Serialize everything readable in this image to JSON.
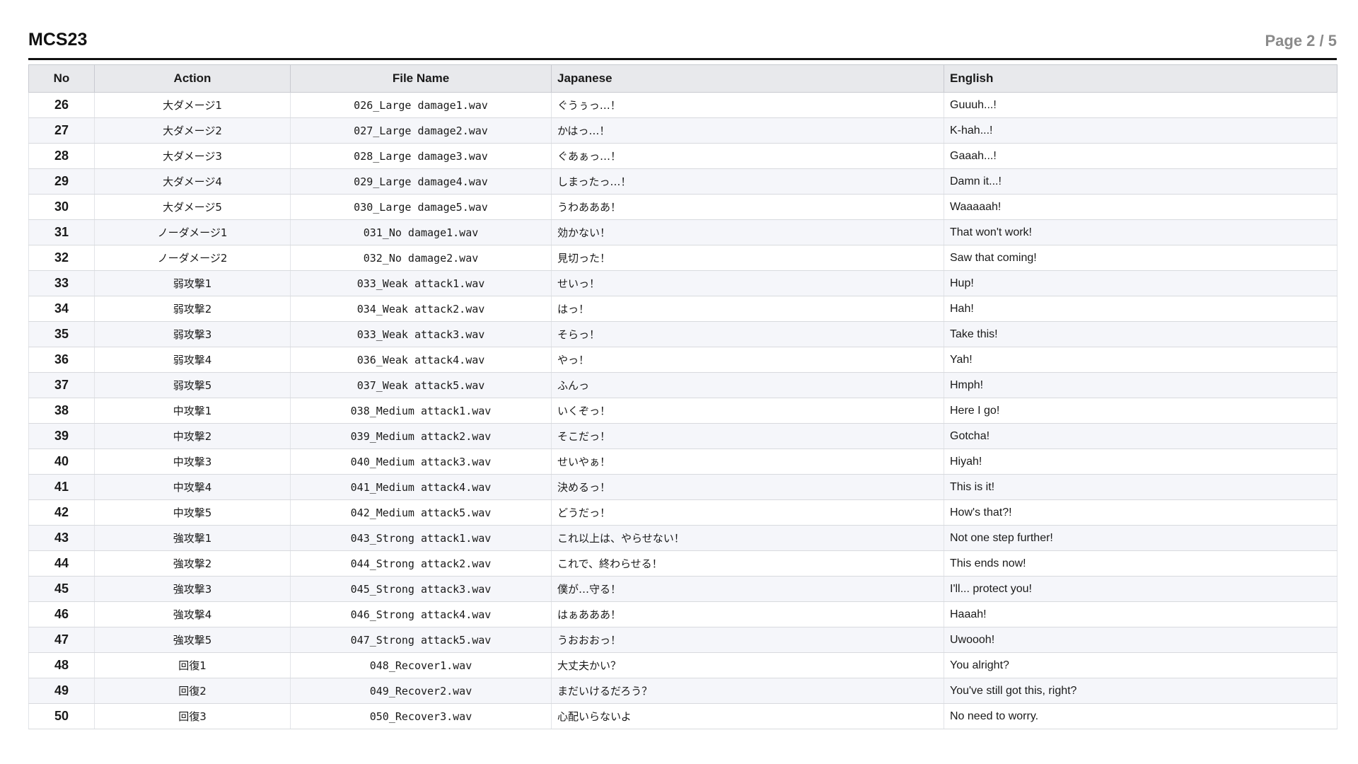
{
  "document": {
    "title": "MCS23",
    "page_indicator": "Page 2 / 5"
  },
  "table": {
    "headers": {
      "no": "No",
      "action": "Action",
      "file_name": "File Name",
      "japanese": "Japanese",
      "english": "English"
    },
    "rows": [
      {
        "no": "26",
        "action": "大ダメージ1",
        "file_name": "026_Large damage1.wav",
        "japanese": "ぐうぅっ…！",
        "english": "Guuuh...!"
      },
      {
        "no": "27",
        "action": "大ダメージ2",
        "file_name": "027_Large damage2.wav",
        "japanese": "かはっ…！",
        "english": "K-hah...!"
      },
      {
        "no": "28",
        "action": "大ダメージ3",
        "file_name": "028_Large damage3.wav",
        "japanese": "ぐあぁっ…！",
        "english": "Gaaah...!"
      },
      {
        "no": "29",
        "action": "大ダメージ4",
        "file_name": "029_Large damage4.wav",
        "japanese": "しまったっ…！",
        "english": "Damn it...!"
      },
      {
        "no": "30",
        "action": "大ダメージ5",
        "file_name": "030_Large damage5.wav",
        "japanese": "うわあああ！",
        "english": "Waaaaah!"
      },
      {
        "no": "31",
        "action": "ノーダメージ1",
        "file_name": "031_No damage1.wav",
        "japanese": "効かない！",
        "english": "That won't work!"
      },
      {
        "no": "32",
        "action": "ノーダメージ2",
        "file_name": "032_No damage2.wav",
        "japanese": "見切った！",
        "english": "Saw that coming!"
      },
      {
        "no": "33",
        "action": "弱攻撃1",
        "file_name": "033_Weak attack1.wav",
        "japanese": "せいっ！",
        "english": "Hup!"
      },
      {
        "no": "34",
        "action": "弱攻撃2",
        "file_name": "034_Weak attack2.wav",
        "japanese": "はっ！",
        "english": "Hah!"
      },
      {
        "no": "35",
        "action": "弱攻撃3",
        "file_name": "033_Weak attack3.wav",
        "japanese": "そらっ！",
        "english": "Take this!"
      },
      {
        "no": "36",
        "action": "弱攻撃4",
        "file_name": "036_Weak attack4.wav",
        "japanese": "やっ！",
        "english": "Yah!"
      },
      {
        "no": "37",
        "action": "弱攻撃5",
        "file_name": "037_Weak attack5.wav",
        "japanese": "ふんっ",
        "english": "Hmph!"
      },
      {
        "no": "38",
        "action": "中攻撃1",
        "file_name": "038_Medium attack1.wav",
        "japanese": "いくぞっ！",
        "english": "Here I go!"
      },
      {
        "no": "39",
        "action": "中攻撃2",
        "file_name": "039_Medium attack2.wav",
        "japanese": "そこだっ！",
        "english": "Gotcha!"
      },
      {
        "no": "40",
        "action": "中攻撃3",
        "file_name": "040_Medium attack3.wav",
        "japanese": "せいやぁ！",
        "english": "Hiyah!"
      },
      {
        "no": "41",
        "action": "中攻撃4",
        "file_name": "041_Medium attack4.wav",
        "japanese": "決めるっ！",
        "english": "This is it!"
      },
      {
        "no": "42",
        "action": "中攻撃5",
        "file_name": "042_Medium attack5.wav",
        "japanese": "どうだっ！",
        "english": "How's that?!"
      },
      {
        "no": "43",
        "action": "強攻撃1",
        "file_name": "043_Strong attack1.wav",
        "japanese": "これ以上は、やらせない！",
        "english": "Not one step further!"
      },
      {
        "no": "44",
        "action": "強攻撃2",
        "file_name": "044_Strong attack2.wav",
        "japanese": "これで、終わらせる！",
        "english": "This ends now!"
      },
      {
        "no": "45",
        "action": "強攻撃3",
        "file_name": "045_Strong attack3.wav",
        "japanese": "僕が…守る！",
        "english": "I'll... protect you!"
      },
      {
        "no": "46",
        "action": "強攻撃4",
        "file_name": "046_Strong attack4.wav",
        "japanese": "はぁあああ！",
        "english": "Haaah!"
      },
      {
        "no": "47",
        "action": "強攻撃5",
        "file_name": "047_Strong attack5.wav",
        "japanese": "うおおおっ！",
        "english": "Uwoooh!"
      },
      {
        "no": "48",
        "action": "回復1",
        "file_name": "048_Recover1.wav",
        "japanese": "大丈夫かい？",
        "english": "You alright?"
      },
      {
        "no": "49",
        "action": "回復2",
        "file_name": "049_Recover2.wav",
        "japanese": "まだいけるだろう？",
        "english": "You've still got this, right?"
      },
      {
        "no": "50",
        "action": "回復3",
        "file_name": "050_Recover3.wav",
        "japanese": "心配いらないよ",
        "english": "No need to worry."
      }
    ]
  }
}
